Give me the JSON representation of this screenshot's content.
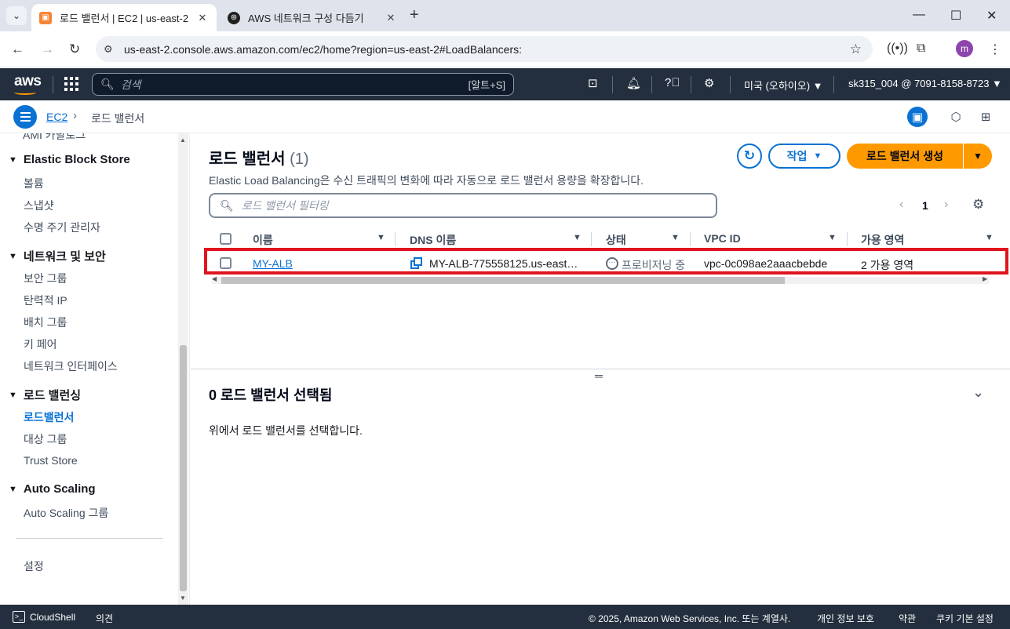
{
  "browser": {
    "tabs": [
      {
        "title": "로드 밸런서 | EC2 | us-east-2",
        "active": true
      },
      {
        "title": "AWS 네트워크 구성 다듬기",
        "active": false
      }
    ],
    "url": "us-east-2.console.aws.amazon.com/ec2/home?region=us-east-2#LoadBalancers:",
    "profile_initial": "m"
  },
  "aws_nav": {
    "logo": "aws",
    "search_placeholder": "검색",
    "search_shortcut": "[알트+S]",
    "region": "미국 (오하이오) ▼",
    "account": "sk315_004 @ 7091-8158-8723 ▼"
  },
  "breadcrumb": {
    "service": "EC2",
    "current": "로드 밸런서"
  },
  "sidebar": {
    "cut_item": "AMI 카탈로그",
    "sections": [
      {
        "title": "Elastic Block Store",
        "items": [
          "볼륨",
          "스냅샷",
          "수명 주기 관리자"
        ]
      },
      {
        "title": "네트워크 및 보안",
        "items": [
          "보안 그룹",
          "탄력적 IP",
          "배치 그룹",
          "키 페어",
          "네트워크 인터페이스"
        ]
      },
      {
        "title": "로드 밸런싱",
        "items": [
          "로드밸런서",
          "대상 그룹",
          "Trust Store"
        ]
      },
      {
        "title": "Auto Scaling",
        "items": [
          "Auto Scaling 그룹"
        ]
      }
    ],
    "settings": "설정"
  },
  "main": {
    "title": "로드 밸런서",
    "count": "(1)",
    "description": "Elastic Load Balancing은 수신 트래픽의 변화에 따라 자동으로 로드 밸런서 용량을 확장합니다.",
    "actions_label": "작업",
    "create_label": "로드 밸런서 생성",
    "filter_placeholder": "로드 밸런서 필터링",
    "page_number": "1",
    "columns": [
      "이름",
      "DNS 이름",
      "상태",
      "VPC ID",
      "가용 영역"
    ],
    "rows": [
      {
        "name": "MY-ALB",
        "dns": "MY-ALB-775558125.us-east…",
        "status": "프로비저닝 중",
        "vpc": "vpc-0c098ae2aaacbebde",
        "az": "2 가용 영역"
      }
    ],
    "detail_title": "0 로드 밸런서 선택됨",
    "detail_text": "위에서 로드 밸런서를 선택합니다."
  },
  "footer": {
    "cloudshell": "CloudShell",
    "feedback": "의견",
    "copyright": "© 2025, Amazon Web Services, Inc. 또는 계열사.",
    "privacy": "개인 정보 보호",
    "terms": "약관",
    "cookies": "쿠키 기본 설정"
  },
  "colors": {
    "aws_nav_bg": "#232f3e",
    "link_blue": "#0972d3",
    "primary_orange": "#ff9900",
    "highlight_red": "#e0141e"
  }
}
